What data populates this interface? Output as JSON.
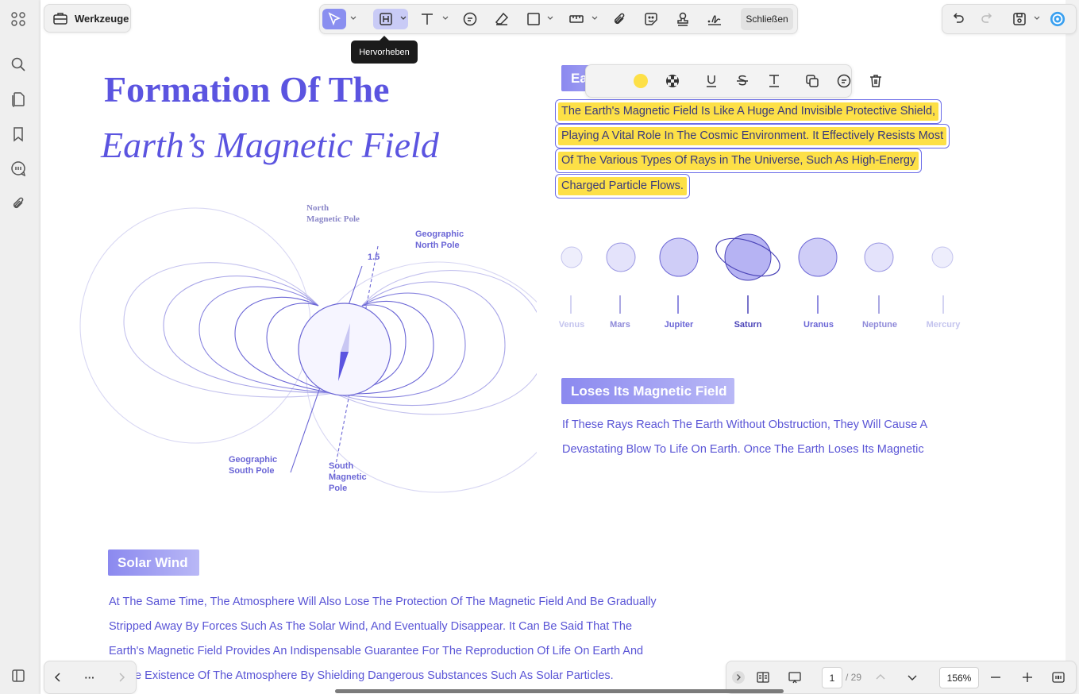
{
  "toolbar": {
    "tools_label": "Werkzeuge",
    "close_label": "Schließen",
    "tooltip": "Hervorheben"
  },
  "document": {
    "title_line1": "Formation Of The",
    "title_line2": "Earth’s Magnetic Field",
    "section_earth_label": "Earth's",
    "highlighted_lines": [
      "The Earth's Magnetic Field Is Like A Huge And Invisible Protective Shield,",
      "Playing A Vital Role In The Cosmic Environment. It Effectively Resists Most",
      "Of The Various Types Of Rays in The Universe, Such As High-Energy",
      "Charged Particle Flows."
    ],
    "diagram": {
      "north_magnetic_pole": [
        "North",
        "Magnetic Pole"
      ],
      "geographic_north_pole": [
        "Geographic",
        "North Pole"
      ],
      "angle_label": "1.5",
      "geographic_south_pole": [
        "Geographic",
        "South Pole"
      ],
      "south_magnetic_pole": [
        "South",
        "Magnetic",
        "Pole"
      ]
    },
    "planets": [
      {
        "name": "Venus",
        "color": "#c4c4ee"
      },
      {
        "name": "Mars",
        "color": "#8f8ad9"
      },
      {
        "name": "Jupiter",
        "color": "#6b66d6"
      },
      {
        "name": "Saturn",
        "color": "#4b44b8"
      },
      {
        "name": "Uranus",
        "color": "#6b66d6"
      },
      {
        "name": "Neptune",
        "color": "#8f8ad9"
      },
      {
        "name": "Mercury",
        "color": "#c4c4ee"
      }
    ],
    "loses_label": "Loses Its Magnetic Field",
    "loses_lines": [
      "If These Rays Reach The Earth Without Obstruction, They Will Cause A",
      "Devastating Blow To Life On Earth. Once The Earth Loses Its Magnetic"
    ],
    "solar_wind_label": "Solar Wind",
    "solar_lines": [
      "At The Same Time, The Atmosphere Will Also Lose The Protection Of The Magnetic Field And Be Gradually",
      "Stripped Away By Forces Such As The Solar Wind, And Eventually Disappear. It Can Be Said That The",
      "Earth's Magnetic Field Provides An Indispensable Guarantee For The Reproduction Of Life On Earth And",
      "Stable Existence Of The Atmosphere By Shielding Dangerous Substances Such As Solar Particles."
    ]
  },
  "popup": {
    "highlight_color": "#fde047"
  },
  "footer": {
    "more_label": "···",
    "current_page": "1",
    "total_pages": "/ 29",
    "zoom": "156%"
  },
  "colors": {
    "accent": "#5b54e0",
    "highlight": "#fde047",
    "selected_tool": "#8a8ff0"
  }
}
